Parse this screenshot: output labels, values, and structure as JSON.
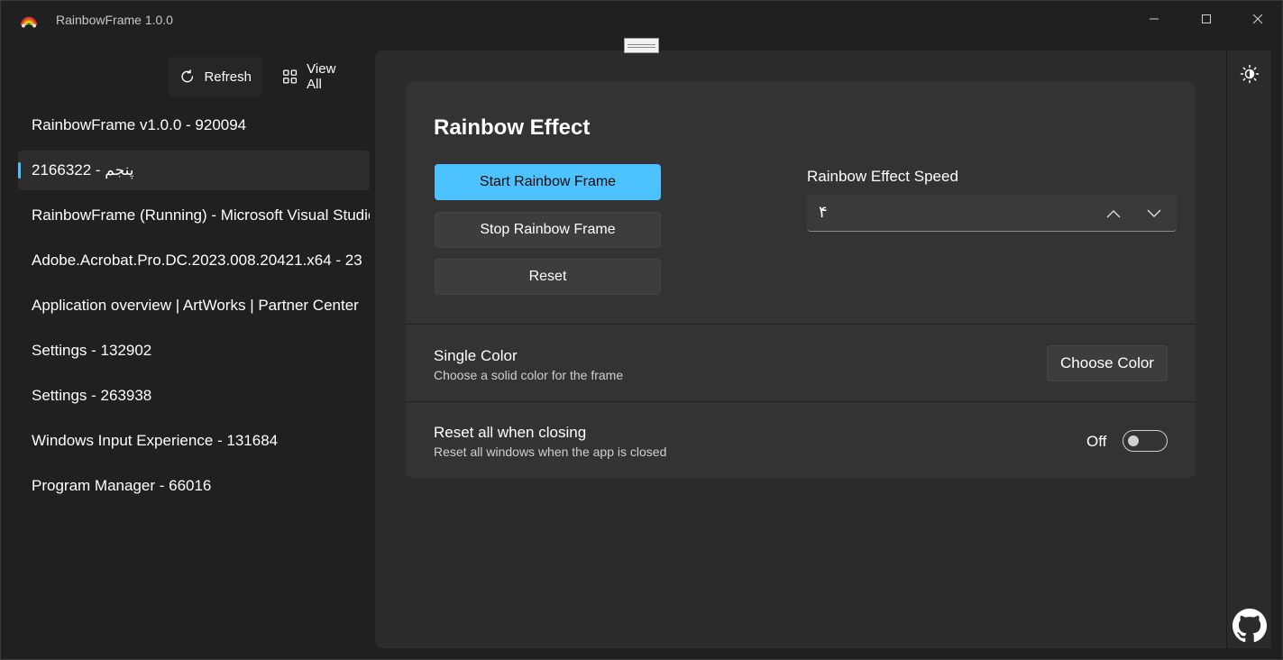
{
  "app": {
    "title": "RainbowFrame 1.0.0"
  },
  "sidebar": {
    "refresh_label": "Refresh",
    "view_all_label": "View All",
    "windows": [
      {
        "label": "RainbowFrame v1.0.0  -  920094",
        "selected": false
      },
      {
        "label": "پنجم  -  2166322",
        "selected": true
      },
      {
        "label": "RainbowFrame (Running) - Microsoft Visual Studio",
        "selected": false
      },
      {
        "label": "Adobe.Acrobat.Pro.DC.2023.008.20421.x64  -  23",
        "selected": false
      },
      {
        "label": "Application overview | ArtWorks | Partner Center",
        "selected": false
      },
      {
        "label": "Settings  -  132902",
        "selected": false
      },
      {
        "label": "Settings  -  263938",
        "selected": false
      },
      {
        "label": "Windows Input Experience  -  131684",
        "selected": false
      },
      {
        "label": "Program Manager  -  66016",
        "selected": false
      }
    ]
  },
  "main": {
    "card_title": "Rainbow Effect",
    "start_label": "Start Rainbow Frame",
    "stop_label": "Stop Rainbow Frame",
    "reset_label": "Reset",
    "speed_label": "Rainbow Effect Speed",
    "speed_value": "۴",
    "single_color": {
      "title": "Single Color",
      "subtitle": "Choose a solid color for the frame",
      "button_label": "Choose Color"
    },
    "reset_closing": {
      "title": "Reset all when closing",
      "subtitle": "Reset all windows when the app is closed",
      "toggle_label": "Off",
      "toggle_on": false
    }
  },
  "colors": {
    "accent": "#4cc2ff",
    "background": "#202020",
    "panel": "#2c2c2c",
    "card": "#333333"
  },
  "icons": {
    "logo": "rainbow-icon",
    "refresh": "refresh-icon",
    "view_all": "grid-icon",
    "theme": "theme-toggle-icon",
    "github": "github-icon"
  }
}
